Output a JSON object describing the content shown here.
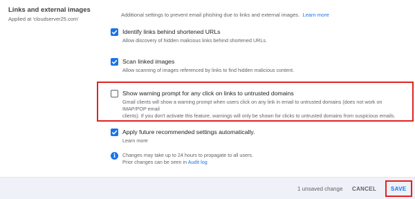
{
  "section": {
    "title": "Links and external images",
    "applied_at": "Applied at 'cloudserver25.com'"
  },
  "intro": {
    "text": "Additional settings to prevent email phishing due to links and external images.",
    "learn_more": "Learn more"
  },
  "settings": [
    {
      "title": "Identify links behind shortened URLs",
      "description": "Allow discovery of hidden malicious links behind shortened URLs.",
      "checked": true
    },
    {
      "title": "Scan linked images",
      "description": "Allow scanning of images referenced by links to find hidden malicious content.",
      "checked": true
    },
    {
      "title": "Show warning prompt for any click on links to untrusted domains",
      "description_line1": "Gmail clients will show a warning prompt when users click on any link in email to untrusted domains (does not work on IMAP/POP email",
      "description_line2": "clients). If you don't activate this feature, warnings will only be shown for clicks to untrusted domains from suspicious emails.",
      "checked": false
    },
    {
      "title": "Apply future recommended settings automatically.",
      "learn_more": "Learn more",
      "checked": true
    }
  ],
  "notice": {
    "line1": "Changes may take up to 24 hours to propagate to all users.",
    "line2_prefix": "Prior changes can be seen in",
    "audit_log": "Audit log"
  },
  "footer": {
    "unsaved": "1 unsaved change",
    "cancel": "CANCEL",
    "save": "SAVE"
  },
  "colors": {
    "accent": "#1a73e8",
    "highlight_border": "#e0211f",
    "footer_bg": "#eef1f7"
  }
}
